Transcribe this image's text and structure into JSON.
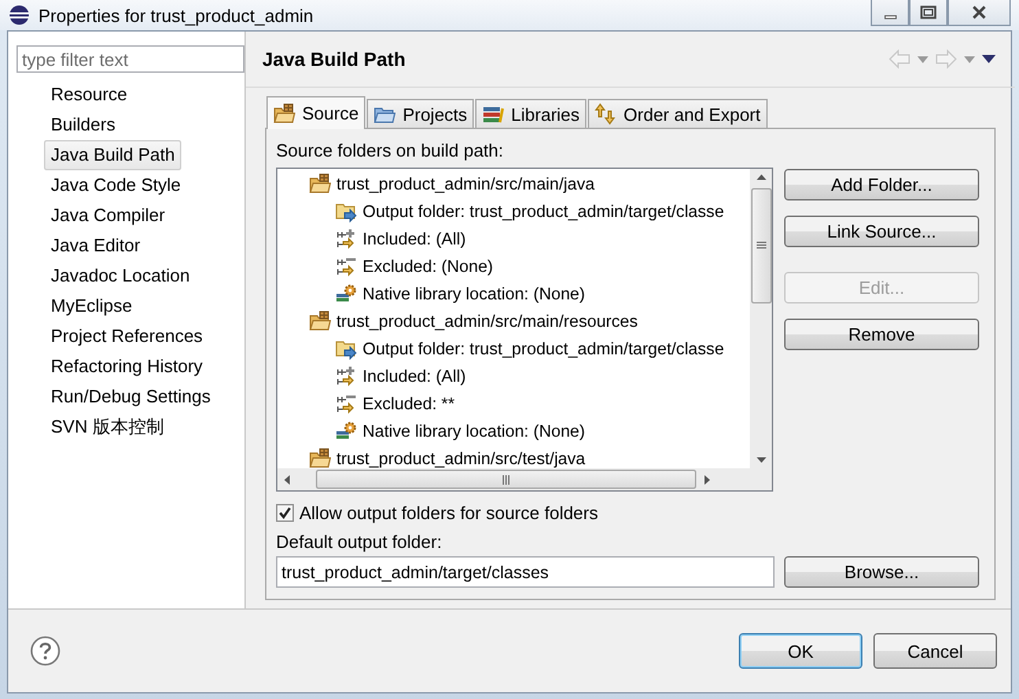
{
  "window": {
    "title": "Properties for trust_product_admin"
  },
  "filter": {
    "placeholder": "type filter text"
  },
  "sidebar": {
    "items": [
      {
        "label": "Resource",
        "selected": false
      },
      {
        "label": "Builders",
        "selected": false
      },
      {
        "label": "Java Build Path",
        "selected": true
      },
      {
        "label": "Java Code Style",
        "selected": false
      },
      {
        "label": "Java Compiler",
        "selected": false
      },
      {
        "label": "Java Editor",
        "selected": false
      },
      {
        "label": "Javadoc Location",
        "selected": false
      },
      {
        "label": "MyEclipse",
        "selected": false
      },
      {
        "label": "Project References",
        "selected": false
      },
      {
        "label": "Refactoring History",
        "selected": false
      },
      {
        "label": "Run/Debug Settings",
        "selected": false
      },
      {
        "label": "SVN 版本控制",
        "selected": false
      }
    ]
  },
  "page": {
    "title": "Java Build Path"
  },
  "tabs": [
    {
      "label": "Source",
      "kind": "source",
      "selected": true
    },
    {
      "label": "Projects",
      "kind": "projects",
      "selected": false
    },
    {
      "label": "Libraries",
      "kind": "libraries",
      "selected": false
    },
    {
      "label": "Order and Export",
      "kind": "order",
      "selected": false
    }
  ],
  "source_tab": {
    "heading": "Source folders on build path:",
    "tree": [
      {
        "label": "trust_product_admin/src/main/java",
        "kind": "source",
        "children": [
          {
            "label": "Output folder: trust_product_admin/target/classe",
            "kind": "output"
          },
          {
            "label": "Included: (All)",
            "kind": "included"
          },
          {
            "label": "Excluded: (None)",
            "kind": "excluded"
          },
          {
            "label": "Native library location: (None)",
            "kind": "native"
          }
        ]
      },
      {
        "label": "trust_product_admin/src/main/resources",
        "kind": "source",
        "children": [
          {
            "label": "Output folder: trust_product_admin/target/classe",
            "kind": "output"
          },
          {
            "label": "Included: (All)",
            "kind": "included"
          },
          {
            "label": "Excluded: **",
            "kind": "excluded"
          },
          {
            "label": "Native library location: (None)",
            "kind": "native"
          }
        ]
      },
      {
        "label": "trust_product_admin/src/test/java",
        "kind": "source"
      }
    ],
    "buttons": [
      {
        "label": "Add Folder...",
        "disabled": false
      },
      {
        "label": "Link Source...",
        "disabled": false
      },
      {
        "label": "Edit...",
        "disabled": true
      },
      {
        "label": "Remove",
        "disabled": false
      }
    ],
    "allow_output": {
      "label": "Allow output folders for source folders",
      "checked": true
    },
    "default_output": {
      "label": "Default output folder:",
      "value": "trust_product_admin/target/classes"
    },
    "browse_button": "Browse..."
  },
  "footer": {
    "buttons": [
      {
        "label": "OK",
        "kind": "default"
      },
      {
        "label": "Cancel",
        "kind": "normal"
      }
    ]
  }
}
